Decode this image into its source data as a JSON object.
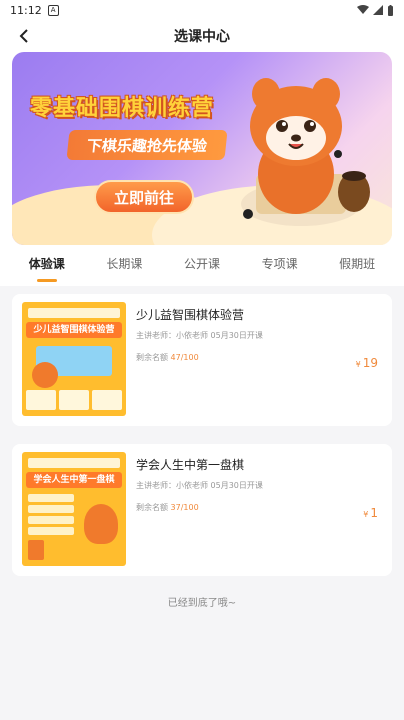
{
  "status_bar": {
    "time": "11:12",
    "notif_badge": "A"
  },
  "header": {
    "title": "选课中心",
    "back_icon": "back-arrow-icon"
  },
  "banner": {
    "headline": "零基础围棋训练营",
    "ribbon": "下棋乐趣抢先体验",
    "cta": "立即前往"
  },
  "tabs": [
    {
      "label": "体验课",
      "active": true
    },
    {
      "label": "长期课",
      "active": false
    },
    {
      "label": "公开课",
      "active": false
    },
    {
      "label": "专项课",
      "active": false
    },
    {
      "label": "假期班",
      "active": false
    }
  ],
  "courses": [
    {
      "name": "少儿益智围棋体验营",
      "teacher": "主讲老师：小依老师 05月30日开课",
      "remain_label": "剩余名额",
      "remain": "47/100",
      "currency": "¥",
      "price": "19",
      "thumb_title": "少儿益智围棋体验营"
    },
    {
      "name": "学会人生中第一盘棋",
      "teacher": "主讲老师：小依老师 05月30日开课",
      "remain_label": "剩余名额",
      "remain": "37/100",
      "currency": "¥",
      "price": "1",
      "thumb_title": "学会人生中第一盘棋"
    }
  ],
  "footer_note": "已经到底了哦~",
  "colors": {
    "accent": "#f59a23",
    "price": "#f08a3c",
    "banner_purple": "#9b7cf0"
  }
}
